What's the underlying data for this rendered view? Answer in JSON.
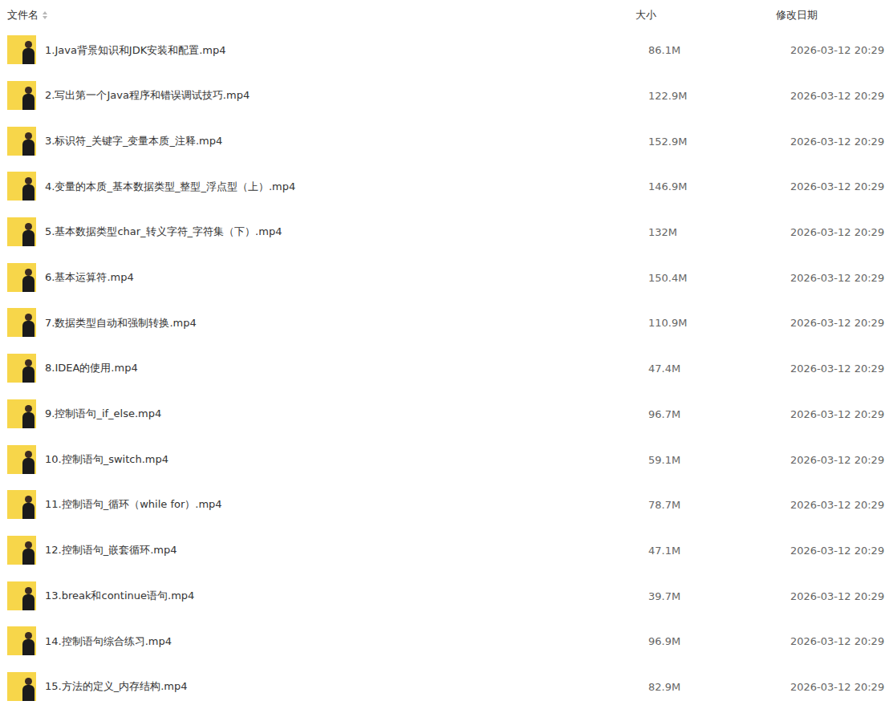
{
  "columns": {
    "name": "文件名",
    "size": "大小",
    "date": "修改日期"
  },
  "files": [
    {
      "name": "1.Java背景知识和JDK安装和配置.mp4",
      "size": "86.1M",
      "date": "2026-03-12 20:29"
    },
    {
      "name": "2.写出第一个Java程序和错误调试技巧.mp4",
      "size": "122.9M",
      "date": "2026-03-12 20:29"
    },
    {
      "name": "3.标识符_关键字_变量本质_注释.mp4",
      "size": "152.9M",
      "date": "2026-03-12 20:29"
    },
    {
      "name": "4.变量的本质_基本数据类型_整型_浮点型（上）.mp4",
      "size": "146.9M",
      "date": "2026-03-12 20:29"
    },
    {
      "name": "5.基本数据类型char_转义字符_字符集（下）.mp4",
      "size": "132M",
      "date": "2026-03-12 20:29"
    },
    {
      "name": "6.基本运算符.mp4",
      "size": "150.4M",
      "date": "2026-03-12 20:29"
    },
    {
      "name": "7.数据类型自动和强制转换.mp4",
      "size": "110.9M",
      "date": "2026-03-12 20:29"
    },
    {
      "name": "8.IDEA的使用.mp4",
      "size": "47.4M",
      "date": "2026-03-12 20:29"
    },
    {
      "name": "9.控制语句_if_else.mp4",
      "size": "96.7M",
      "date": "2026-03-12 20:29"
    },
    {
      "name": "10.控制语句_switch.mp4",
      "size": "59.1M",
      "date": "2026-03-12 20:29"
    },
    {
      "name": "11.控制语句_循环（while for）.mp4",
      "size": "78.7M",
      "date": "2026-03-12 20:29"
    },
    {
      "name": "12.控制语句_嵌套循环.mp4",
      "size": "47.1M",
      "date": "2026-03-12 20:29"
    },
    {
      "name": "13.break和continue语句.mp4",
      "size": "39.7M",
      "date": "2026-03-12 20:29"
    },
    {
      "name": "14.控制语句综合练习.mp4",
      "size": "96.9M",
      "date": "2026-03-12 20:29"
    },
    {
      "name": "15.方法的定义_内存结构.mp4",
      "size": "82.9M",
      "date": "2026-03-12 20:29"
    }
  ]
}
